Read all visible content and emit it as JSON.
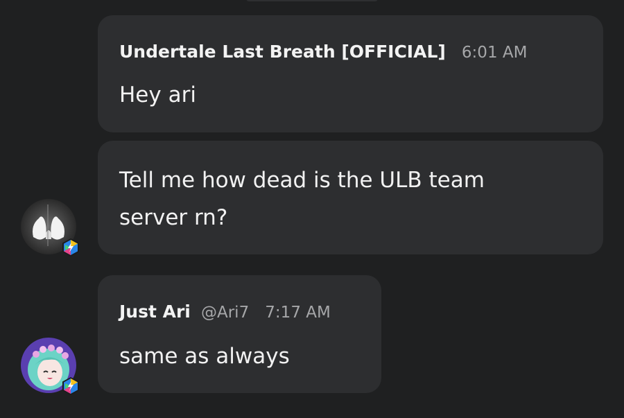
{
  "messages": [
    {
      "author": "Undertale Last Breath [OFFICIAL]",
      "time": "6:01 AM",
      "lines": [
        "Hey ari"
      ]
    },
    {
      "lines": [
        "Tell me how dead is the ULB team",
        "server rn?"
      ]
    },
    {
      "author": "Just Ari",
      "handle": "@Ari7",
      "time": "7:17 AM",
      "lines": [
        "same as always"
      ]
    }
  ],
  "avatars": {
    "first": "ghost-avatar",
    "second": "anime-girl-avatar",
    "badge_icon": "lightning-badge-icon"
  },
  "colors": {
    "background": "#1f2021",
    "bubble": "#2d2e30",
    "meta_text": "#a6a7a9"
  }
}
